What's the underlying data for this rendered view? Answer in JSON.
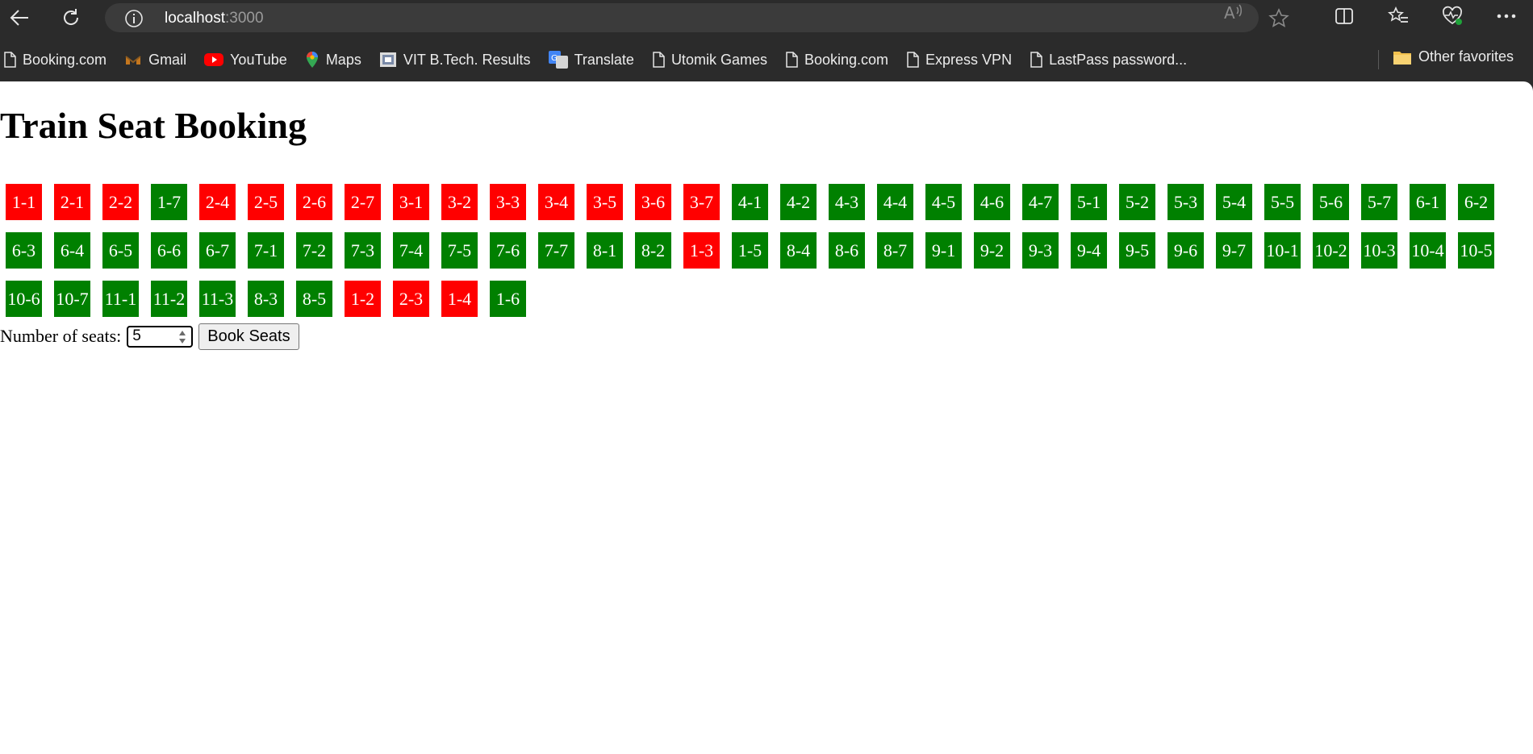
{
  "browser": {
    "url_host": "localhost",
    "url_port": ":3000"
  },
  "bookmarks": [
    {
      "label": "Booking.com",
      "icon": "page-icon"
    },
    {
      "label": "Gmail",
      "icon": "gmail-icon"
    },
    {
      "label": "YouTube",
      "icon": "youtube-icon"
    },
    {
      "label": "Maps",
      "icon": "maps-icon"
    },
    {
      "label": "VIT B.Tech. Results",
      "icon": "vit-icon"
    },
    {
      "label": "Translate",
      "icon": "translate-icon"
    },
    {
      "label": "Utomik Games",
      "icon": "page-icon"
    },
    {
      "label": "Booking.com",
      "icon": "page-icon"
    },
    {
      "label": "Express VPN",
      "icon": "page-icon"
    },
    {
      "label": "LastPass password...",
      "icon": "page-icon"
    }
  ],
  "other_favorites": "Other favorites",
  "page": {
    "title": "Train Seat Booking",
    "seats_label": "Number of seats:",
    "seats_value": "5",
    "book_button": "Book Seats"
  },
  "colors": {
    "booked": "#ff0000",
    "available": "#008000"
  },
  "seats": [
    {
      "id": "1-1",
      "booked": true
    },
    {
      "id": "2-1",
      "booked": true
    },
    {
      "id": "2-2",
      "booked": true
    },
    {
      "id": "1-7",
      "booked": false
    },
    {
      "id": "2-4",
      "booked": true
    },
    {
      "id": "2-5",
      "booked": true
    },
    {
      "id": "2-6",
      "booked": true
    },
    {
      "id": "2-7",
      "booked": true
    },
    {
      "id": "3-1",
      "booked": true
    },
    {
      "id": "3-2",
      "booked": true
    },
    {
      "id": "3-3",
      "booked": true
    },
    {
      "id": "3-4",
      "booked": true
    },
    {
      "id": "3-5",
      "booked": true
    },
    {
      "id": "3-6",
      "booked": true
    },
    {
      "id": "3-7",
      "booked": true
    },
    {
      "id": "4-1",
      "booked": false
    },
    {
      "id": "4-2",
      "booked": false
    },
    {
      "id": "4-3",
      "booked": false
    },
    {
      "id": "4-4",
      "booked": false
    },
    {
      "id": "4-5",
      "booked": false
    },
    {
      "id": "4-6",
      "booked": false
    },
    {
      "id": "4-7",
      "booked": false
    },
    {
      "id": "5-1",
      "booked": false
    },
    {
      "id": "5-2",
      "booked": false
    },
    {
      "id": "5-3",
      "booked": false
    },
    {
      "id": "5-4",
      "booked": false
    },
    {
      "id": "5-5",
      "booked": false
    },
    {
      "id": "5-6",
      "booked": false
    },
    {
      "id": "5-7",
      "booked": false
    },
    {
      "id": "6-1",
      "booked": false
    },
    {
      "id": "6-2",
      "booked": false
    },
    {
      "id": "6-3",
      "booked": false
    },
    {
      "id": "6-4",
      "booked": false
    },
    {
      "id": "6-5",
      "booked": false
    },
    {
      "id": "6-6",
      "booked": false
    },
    {
      "id": "6-7",
      "booked": false
    },
    {
      "id": "7-1",
      "booked": false
    },
    {
      "id": "7-2",
      "booked": false
    },
    {
      "id": "7-3",
      "booked": false
    },
    {
      "id": "7-4",
      "booked": false
    },
    {
      "id": "7-5",
      "booked": false
    },
    {
      "id": "7-6",
      "booked": false
    },
    {
      "id": "7-7",
      "booked": false
    },
    {
      "id": "8-1",
      "booked": false
    },
    {
      "id": "8-2",
      "booked": false
    },
    {
      "id": "1-3",
      "booked": true
    },
    {
      "id": "1-5",
      "booked": false
    },
    {
      "id": "8-4",
      "booked": false
    },
    {
      "id": "8-6",
      "booked": false
    },
    {
      "id": "8-7",
      "booked": false
    },
    {
      "id": "9-1",
      "booked": false
    },
    {
      "id": "9-2",
      "booked": false
    },
    {
      "id": "9-3",
      "booked": false
    },
    {
      "id": "9-4",
      "booked": false
    },
    {
      "id": "9-5",
      "booked": false
    },
    {
      "id": "9-6",
      "booked": false
    },
    {
      "id": "9-7",
      "booked": false
    },
    {
      "id": "10-1",
      "booked": false
    },
    {
      "id": "10-2",
      "booked": false
    },
    {
      "id": "10-3",
      "booked": false
    },
    {
      "id": "10-4",
      "booked": false
    },
    {
      "id": "10-5",
      "booked": false
    },
    {
      "id": "10-6",
      "booked": false
    },
    {
      "id": "10-7",
      "booked": false
    },
    {
      "id": "11-1",
      "booked": false
    },
    {
      "id": "11-2",
      "booked": false
    },
    {
      "id": "11-3",
      "booked": false
    },
    {
      "id": "8-3",
      "booked": false
    },
    {
      "id": "8-5",
      "booked": false
    },
    {
      "id": "1-2",
      "booked": true
    },
    {
      "id": "2-3",
      "booked": true
    },
    {
      "id": "1-4",
      "booked": true
    },
    {
      "id": "1-6",
      "booked": false
    }
  ]
}
